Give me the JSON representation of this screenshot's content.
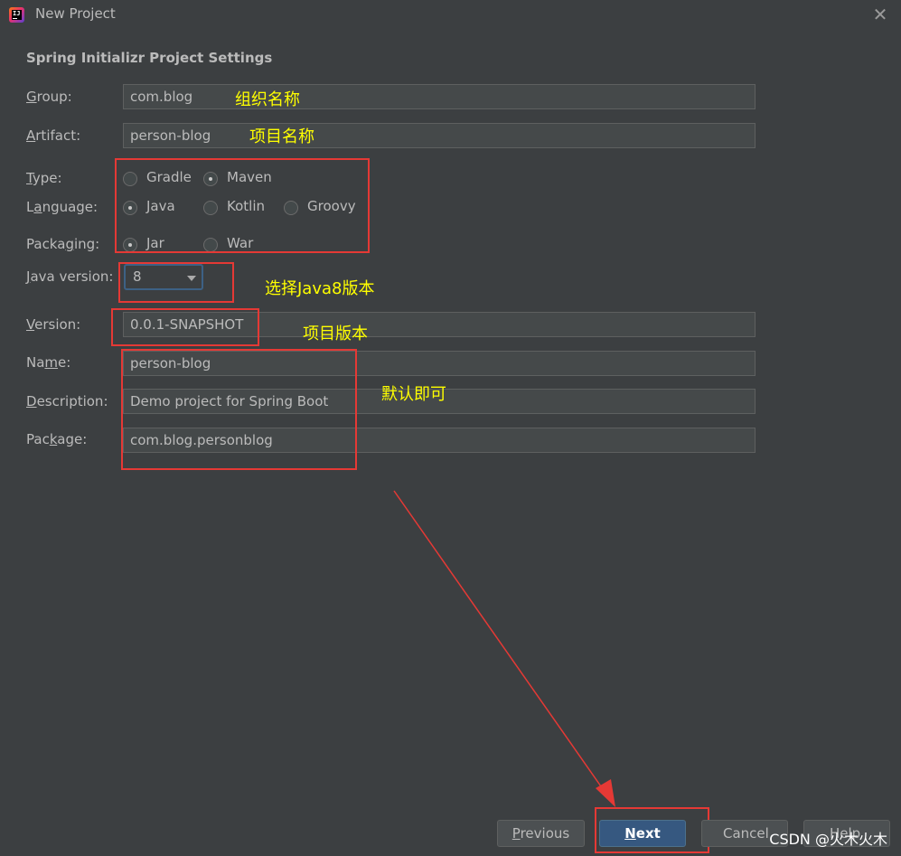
{
  "window": {
    "title": "New Project",
    "close": "✕"
  },
  "section_title": "Spring Initializr Project Settings",
  "fields": {
    "group": {
      "mnemonic": "G",
      "rest": "roup:",
      "value": "com.blog"
    },
    "artifact": {
      "mnemonic": "A",
      "rest": "rtifact:",
      "value": "person-blog"
    },
    "version": {
      "mnemonic": "V",
      "rest": "ersion:",
      "value": "0.0.1-SNAPSHOT"
    },
    "name": {
      "pre": "Na",
      "mnemonic": "m",
      "rest": "e:",
      "value": "person-blog"
    },
    "description": {
      "mnemonic": "D",
      "rest": "escription:",
      "value": "Demo project for Spring Boot"
    },
    "package": {
      "pre": "Pac",
      "mnemonic": "k",
      "rest": "age:",
      "value": "com.blog.personblog"
    }
  },
  "type": {
    "mnemonic": "T",
    "rest": "ype:",
    "options": [
      "Gradle",
      "Maven"
    ],
    "selected": "Maven"
  },
  "language": {
    "pre": "L",
    "mnemonic": "a",
    "rest": "nguage:",
    "options": [
      "Java",
      "Kotlin",
      "Groovy"
    ],
    "selected": "Java"
  },
  "packaging": {
    "pre": "Packa",
    "mnemonic": "g",
    "rest": "ing:",
    "options": [
      "Jar",
      "War"
    ],
    "selected": "Jar"
  },
  "java_version": {
    "mnemonic": "J",
    "rest": "ava version:",
    "value": "8"
  },
  "annotations": {
    "group": "组织名称",
    "artifact": "项目名称",
    "java_version": "选择Java8版本",
    "version": "项目版本",
    "defaults": "默认即可"
  },
  "buttons": {
    "previous": {
      "mnemonic": "P",
      "rest": "revious"
    },
    "next": {
      "mnemonic": "N",
      "rest": "ext"
    },
    "cancel": "Cancel",
    "help": "Help"
  },
  "watermark": "CSDN @火木火木",
  "colors": {
    "annotation": "#ffff00",
    "highlight_box": "#e53935",
    "primary_button": "#365880",
    "background": "#3c3f41"
  }
}
